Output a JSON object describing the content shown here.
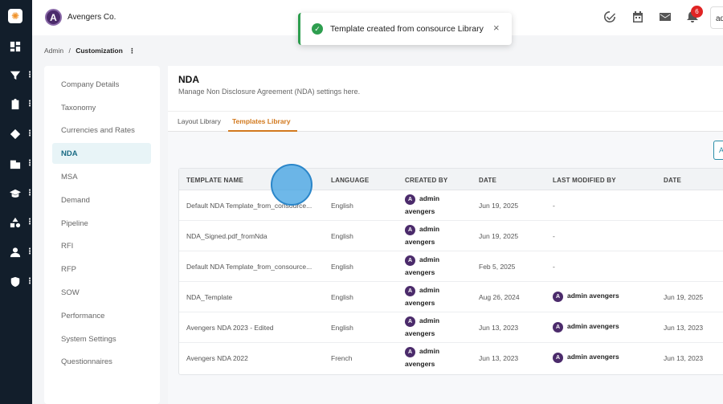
{
  "app": {
    "name": "Avengers Co.",
    "avatar_letter": "A",
    "user_initials": "ad",
    "notification_count": "6"
  },
  "toast": {
    "message": "Template created from consource Library",
    "close": "×"
  },
  "breadcrumb": {
    "root": "Admin",
    "sep": "/",
    "current": "Customization",
    "more": "⋮"
  },
  "sidebar": {
    "items": [
      {
        "label": "Company Details"
      },
      {
        "label": "Taxonomy"
      },
      {
        "label": "Currencies and Rates"
      },
      {
        "label": "NDA"
      },
      {
        "label": "MSA"
      },
      {
        "label": "Demand"
      },
      {
        "label": "Pipeline"
      },
      {
        "label": "RFI"
      },
      {
        "label": "RFP"
      },
      {
        "label": "SOW"
      },
      {
        "label": "Performance"
      },
      {
        "label": "System Settings"
      },
      {
        "label": "Questionnaires"
      }
    ],
    "active": "NDA"
  },
  "panel": {
    "title": "NDA",
    "subtitle": "Manage Non Disclosure Agreement (NDA) settings here.",
    "tabs": [
      "Layout Library",
      "Templates Library"
    ],
    "active_tab": "Templates Library",
    "add_label": "A"
  },
  "table": {
    "headers": [
      "TEMPLATE NAME",
      "LANGUAGE",
      "CREATED BY",
      "DATE",
      "LAST MODIFIED BY",
      "DATE"
    ],
    "rows": [
      {
        "name": "Default NDA Template_from_consource...",
        "language": "English",
        "created_by_1": "admin",
        "created_by_2": "avengers",
        "date": "Jun 19, 2025",
        "modified_by": "-",
        "modified_date": ""
      },
      {
        "name": "NDA_Signed.pdf_fromNda",
        "language": "English",
        "created_by_1": "admin",
        "created_by_2": "avengers",
        "date": "Jun 19, 2025",
        "modified_by": "-",
        "modified_date": ""
      },
      {
        "name": "Default NDA Template_from_consource...",
        "language": "English",
        "created_by_1": "admin",
        "created_by_2": "avengers",
        "date": "Feb 5, 2025",
        "modified_by": "-",
        "modified_date": ""
      },
      {
        "name": "NDA_Template",
        "language": "English",
        "created_by_1": "admin",
        "created_by_2": "avengers",
        "date": "Aug 26, 2024",
        "modified_by": "admin avengers",
        "modified_date": "Jun 19, 2025"
      },
      {
        "name": "Avengers NDA 2023 - Edited",
        "language": "English",
        "created_by_1": "admin",
        "created_by_2": "avengers",
        "date": "Jun 13, 2023",
        "modified_by": "admin avengers",
        "modified_date": "Jun 13, 2023"
      },
      {
        "name": "Avengers NDA 2022",
        "language": "French",
        "created_by_1": "admin",
        "created_by_2": "avengers",
        "date": "Jun 13, 2023",
        "modified_by": "admin avengers",
        "modified_date": "Jun 13, 2023"
      }
    ]
  },
  "icons": {
    "rail": [
      "dashboard-icon",
      "filter-icon",
      "clipboard-icon",
      "tag-icon",
      "building-icon",
      "graduation-cap-icon",
      "shapes-icon",
      "user-icon",
      "shield-cog-icon"
    ],
    "top": [
      "check-circle-icon",
      "calendar-icon",
      "mail-icon",
      "bell-icon"
    ]
  },
  "colors": {
    "accent": "#d2791e",
    "active_nav": "#1a6b84",
    "success": "#2e9e4f",
    "rail": "#121e2b"
  }
}
